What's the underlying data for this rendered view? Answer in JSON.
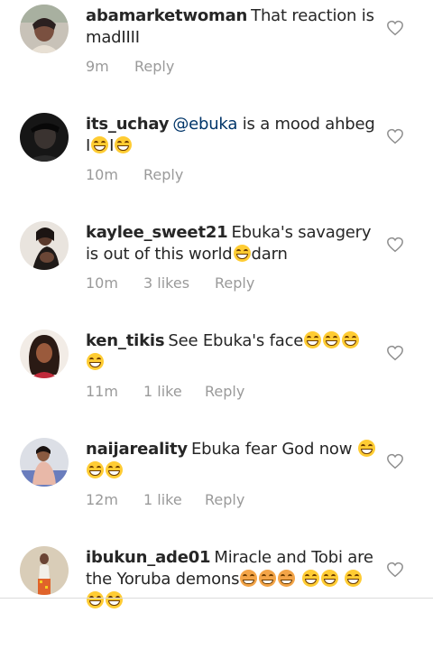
{
  "comments": [
    {
      "username": "abamarketwoman",
      "text": "That reaction is madIIII",
      "time": "9m",
      "likes": "",
      "reply": "Reply"
    },
    {
      "username": "its_uchay",
      "mention": "@ebuka",
      "text": " is a mood ahbeg I",
      "text_mid": "I",
      "time": "10m",
      "likes": "",
      "reply": "Reply"
    },
    {
      "username": "kaylee_sweet21",
      "text": "Ebuka's savagery is out of this world",
      "text_after": "darn",
      "time": "10m",
      "likes": "3 likes",
      "reply": "Reply"
    },
    {
      "username": "ken_tikis",
      "text": "See Ebuka's face",
      "time": "11m",
      "likes": "1 like",
      "reply": "Reply"
    },
    {
      "username": "naijareality",
      "text": "Ebuka fear God now",
      "time": "12m",
      "likes": "1 like",
      "reply": "Reply"
    },
    {
      "username": "ibukun_ade01",
      "text": "Miracle and Tobi are the Yoruba demons",
      "time": "",
      "likes": "",
      "reply": ""
    }
  ],
  "icons": {
    "like": "heart-outline-icon",
    "emoji": "grinning-face-emoji",
    "devil": "smiling-devil-emoji"
  },
  "colors": {
    "username": "#262626",
    "mention": "#003569",
    "meta": "#9a9a9a",
    "heart_stroke": "#8e8e8e",
    "emoji": "#ffcc33"
  }
}
